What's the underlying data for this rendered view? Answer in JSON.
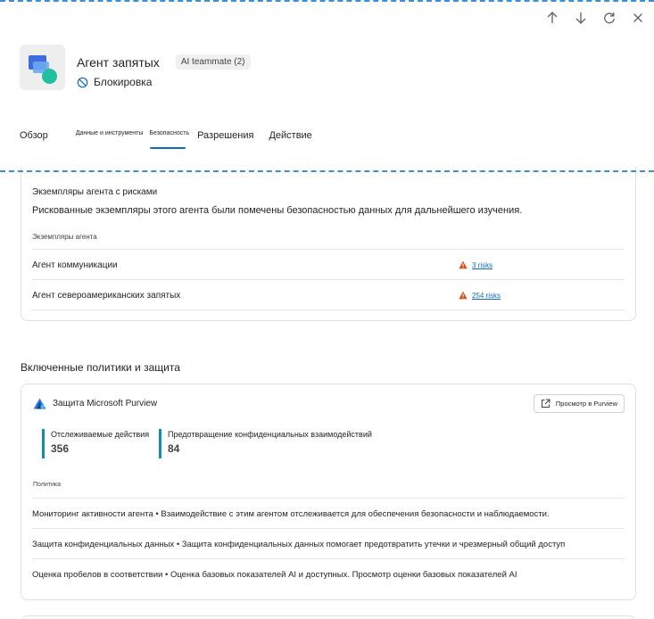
{
  "header": {
    "title": "Агент запятых",
    "badge": "AI teammate (2)",
    "status": "Блокировка"
  },
  "tabs": [
    {
      "label": "Обзор",
      "size": "big"
    },
    {
      "label": "Данные и инструменты",
      "size": "small"
    },
    {
      "label": "Безопасность",
      "size": "small",
      "active": true
    },
    {
      "label": "Разрешения",
      "size": "big"
    },
    {
      "label": "Действие",
      "size": "big"
    }
  ],
  "risk_card": {
    "title": "Экземпляры агента с рисками",
    "description": "Рискованные экземпляры этого агента были помечены безопасностью данных для дальнейшего изучения.",
    "column_header": "Экземпляры агента",
    "rows": [
      {
        "name": "Агент коммуникации",
        "risk": "3 risks"
      },
      {
        "name": "Агент североамериканских запятых",
        "risk": "254 risks"
      }
    ]
  },
  "policies_section": {
    "title": "Включенные политики и защита"
  },
  "purview_card": {
    "title": "Защита Microsoft Purview",
    "view_button": "Просмотр в Purview",
    "metrics": [
      {
        "label": "Отслеживаемые действия",
        "value": "356"
      },
      {
        "label": "Предотвращение конфиденциальных взаимодействий",
        "value": "84"
      }
    ],
    "column_header": "Политика",
    "rows": [
      "Мониторинг активности агента • Взаимодействие с этим агентом отслеживается для обеспечения безопасности и наблюдаемости.",
      "Защита конфиденциальных данных • Защита конфиденциальных данных помогает предотвратить утечки и чрезмерный общий доступ",
      "Оценка пробелов в соответствии • Оценка базовых показателей AI и доступных. Просмотр оценки базовых показателей AI"
    ]
  },
  "colors": {
    "accent": "#0f6cbd",
    "metric_bar": "#0f8fb0",
    "warning": "#d94d16",
    "icon_green": "#1fbfa0",
    "icon_blue": "#3d6be0"
  },
  "icons": {
    "up": "arrow-up-icon",
    "down": "arrow-down-icon",
    "refresh": "refresh-icon",
    "close": "close-icon",
    "blocked": "blocked-icon",
    "warning": "warning-icon",
    "purview": "purview-icon",
    "open_external": "open-external-icon"
  }
}
